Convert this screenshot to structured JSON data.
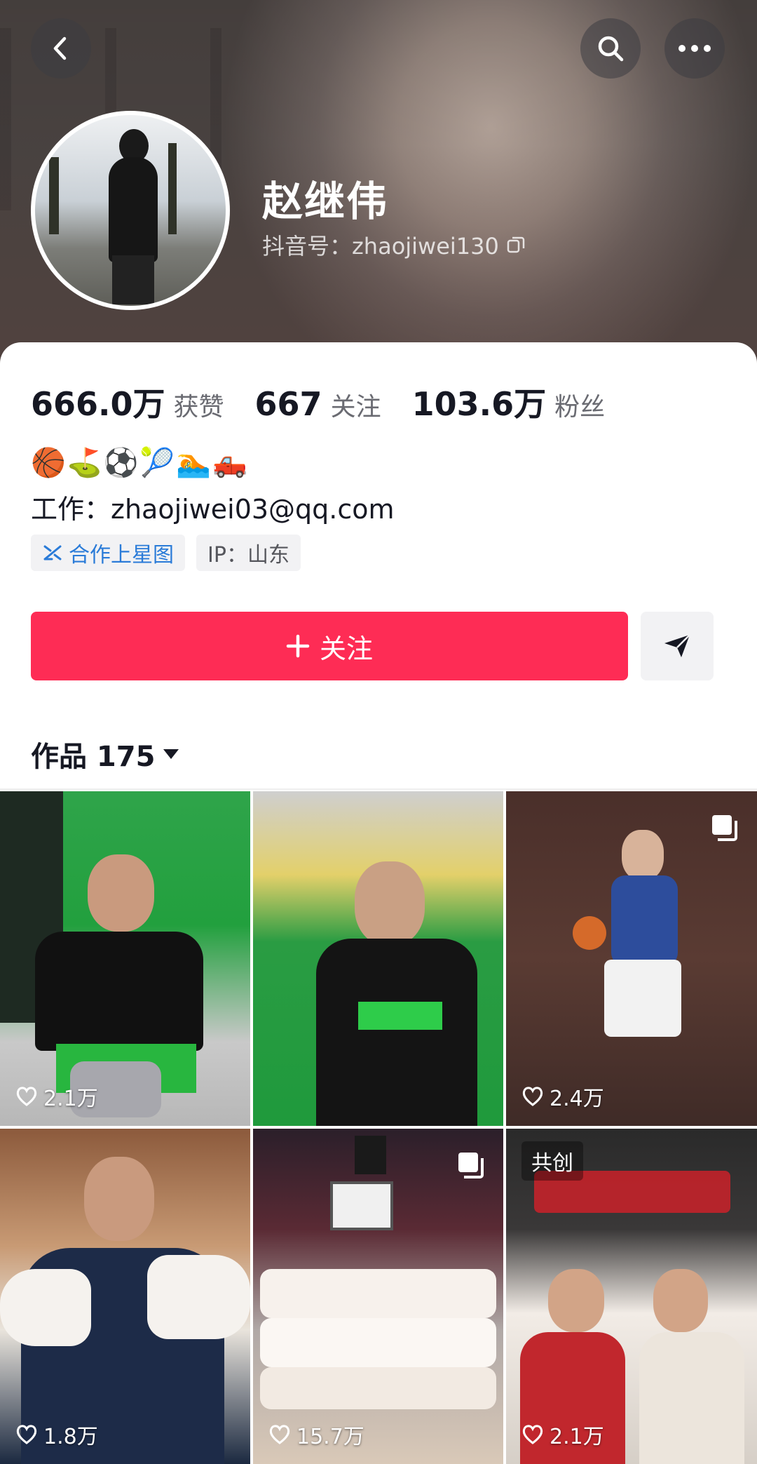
{
  "header": {
    "name": "赵继伟",
    "handle": "抖音号：zhaojiwei130"
  },
  "stats": [
    {
      "value": "666.0万",
      "label": "获赞"
    },
    {
      "value": "667",
      "label": "关注"
    },
    {
      "value": "103.6万",
      "label": "粉丝"
    }
  ],
  "bio": {
    "emojis": "🏀⛳⚽🎾🏊🛻",
    "work": "工作：zhaojiwei03@qq.com"
  },
  "tags": {
    "cooperate": "合作上星图",
    "ip": "IP：山东"
  },
  "actions": {
    "follow_label": "关注"
  },
  "works": {
    "label": "作品 175"
  },
  "videos": [
    {
      "likes": "2.1万"
    },
    {
      "likes": ""
    },
    {
      "likes": "2.4万"
    },
    {
      "likes": "1.8万"
    },
    {
      "likes": "15.7万"
    },
    {
      "likes": "2.1万",
      "badge": "共创"
    }
  ],
  "colors": {
    "follow": "#fe2c55",
    "link_blue": "#2a7bd8"
  }
}
